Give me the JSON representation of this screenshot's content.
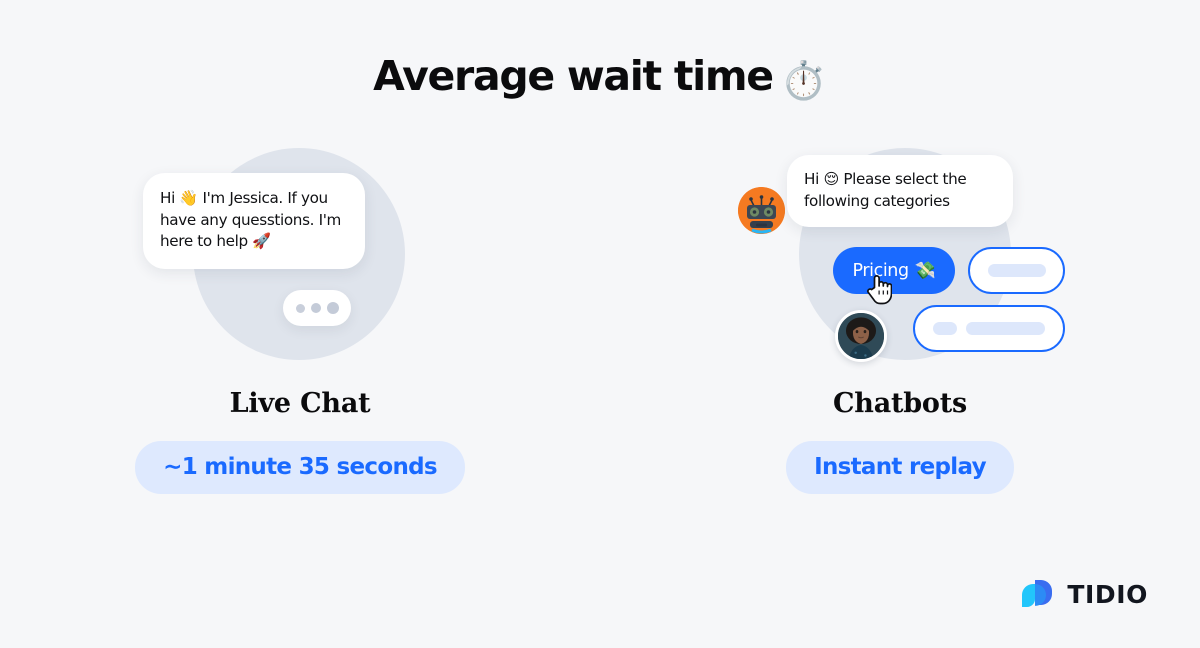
{
  "page": {
    "background_color": "#f6f7f9",
    "accent_color": "#1a6aff",
    "badge_background": "#dee9fe",
    "circle_color": "#dfe4ec"
  },
  "header": {
    "title": "Average wait time",
    "title_emoji": "⏱️",
    "title_emoji_name": "stopwatch-emoji"
  },
  "columns": [
    {
      "id": "live-chat",
      "label": "Live Chat",
      "badge": "∼1 minute 35 seconds",
      "bubble": {
        "line1_prefix": "Hi ",
        "line1_emoji": "👋",
        "text": "Hi 👋 I'm Jessica. If you have any quesstions. I'm here to help 🚀",
        "agent_name": "Jessica",
        "end_emoji": "🚀"
      },
      "typing_indicator": {
        "dots": 3,
        "dot_color": "#c4cbd8"
      }
    },
    {
      "id": "chatbots",
      "label": "Chatbots",
      "badge": "Instant replay",
      "bubble": {
        "text": "Hi 😌 Please select the following categories",
        "emoji": "😌"
      },
      "avatars": {
        "bot": "robot-avatar",
        "person": "person-avatar"
      },
      "quick_replies": [
        {
          "label": "Pricing",
          "emoji": "💸",
          "style": "filled",
          "selected": true
        },
        {
          "label": "",
          "style": "outlined",
          "placeholder_bars": [
            "mid"
          ]
        },
        {
          "label": "",
          "style": "outlined",
          "placeholder_bars": [
            "short",
            "long"
          ]
        }
      ],
      "cursor": "pointing-hand-cursor"
    }
  ],
  "footer": {
    "brand": "TIDIO"
  }
}
